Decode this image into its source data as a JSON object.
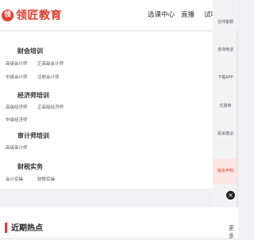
{
  "brand": {
    "seal_char": "领",
    "name": "领匠教育",
    "accent": "#e33b2d"
  },
  "nav": {
    "items": [
      {
        "label": "选课中心"
      },
      {
        "label": "直播"
      },
      {
        "label": "试听"
      }
    ]
  },
  "menu": {
    "groups": [
      {
        "title": "财会培训",
        "links": [
          "高级会计师",
          "正高级会计师",
          "中级会计师",
          "注册会计师"
        ]
      },
      {
        "title": "经济师培训",
        "links": [
          "高级经济师",
          "正高级经济师",
          "中级经济师"
        ]
      },
      {
        "title": "审计师培训",
        "links": [
          "高级审计师"
        ]
      },
      {
        "title": "财税实务",
        "links": [
          "会计实操",
          "财税实操"
        ]
      }
    ]
  },
  "right_sidebar": {
    "items": [
      {
        "label": "在线客服"
      },
      {
        "label": "咨询电话"
      },
      {
        "label": "下载APP"
      },
      {
        "label": "优惠券"
      },
      {
        "label": "投诉建议"
      },
      {
        "label": "版本声明"
      }
    ],
    "close_icon": "close-icon"
  },
  "hot": {
    "title": "近期热点",
    "more_label": "更多"
  }
}
